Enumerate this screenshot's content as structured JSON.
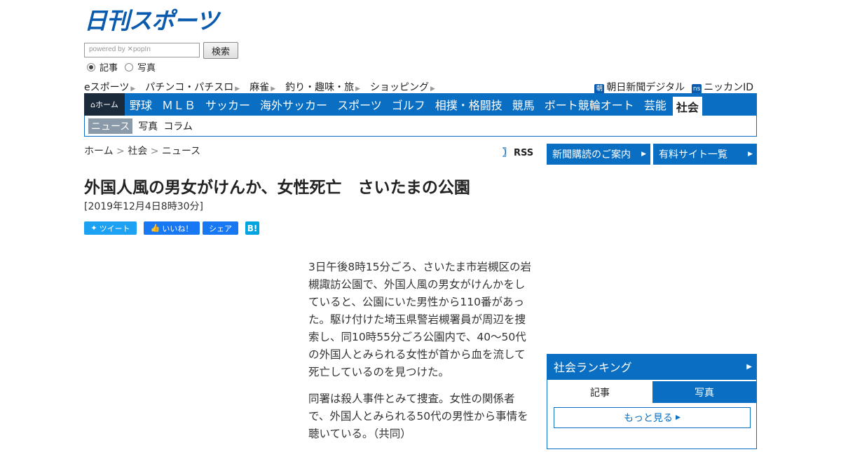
{
  "header": {
    "logo_text": "日刊スポーツ",
    "search_placeholder": "powered by ✕popIn",
    "search_button": "検索",
    "radio_options": [
      {
        "label": "記事",
        "selected": true
      },
      {
        "label": "写真",
        "selected": false
      }
    ],
    "util_links": [
      "eスポーツ",
      "パチンコ・パチスロ",
      "麻雀",
      "釣り・趣味・旅",
      "ショッピング"
    ],
    "util_right": [
      {
        "icon": "asahi-icon",
        "icon_text": "朝",
        "label": "朝日新聞デジタル"
      },
      {
        "icon": "nikkan-id-icon",
        "icon_text": "ns",
        "label": "ニッカンID"
      }
    ]
  },
  "nav": {
    "home_label": "ホーム",
    "items": [
      "野球",
      "ＭＬＢ",
      "サッカー",
      "海外サッカー",
      "スポーツ",
      "ゴルフ",
      "相撲・格闘技",
      "競馬",
      "ボート競輪オート",
      "芸能",
      "社会"
    ],
    "active": "社会",
    "sub_items": [
      "ニュース",
      "写真",
      "コラム"
    ],
    "sub_active": "ニュース"
  },
  "breadcrumb": [
    "ホーム",
    "社会",
    "ニュース"
  ],
  "rss_label": "RSS",
  "side_buttons": [
    "新聞購読のご案内",
    "有料サイト一覧"
  ],
  "article": {
    "headline": "外国人風の男女がけんか、女性死亡　さいたまの公園",
    "date": "[2019年12月4日8時30分]",
    "share": {
      "tweet": "ツイート",
      "like": "いいね！",
      "share": "シェア",
      "hatena": "B!"
    },
    "paragraphs": [
      "3日午後8時15分ごろ、さいたま市岩槻区の岩槻諏訪公園で、外国人風の男女がけんかをしていると、公園にいた男性から110番があった。駆け付けた埼玉県警岩槻署員が周辺を捜索し、同10時55分ごろ公園内で、40～50代の外国人とみられる女性が首から血を流して死亡しているのを見つけた。",
      "同署は殺人事件とみて捜査。女性の関係者で、外国人とみられる50代の男性から事情を聴いている。（共同）"
    ]
  },
  "ranking": {
    "title": "社会ランキング",
    "tabs": [
      "記事",
      "写真"
    ],
    "more": "もっと見る"
  },
  "colors": {
    "brand_blue": "#0a6fc2",
    "home_dark": "#1c2b3b"
  }
}
